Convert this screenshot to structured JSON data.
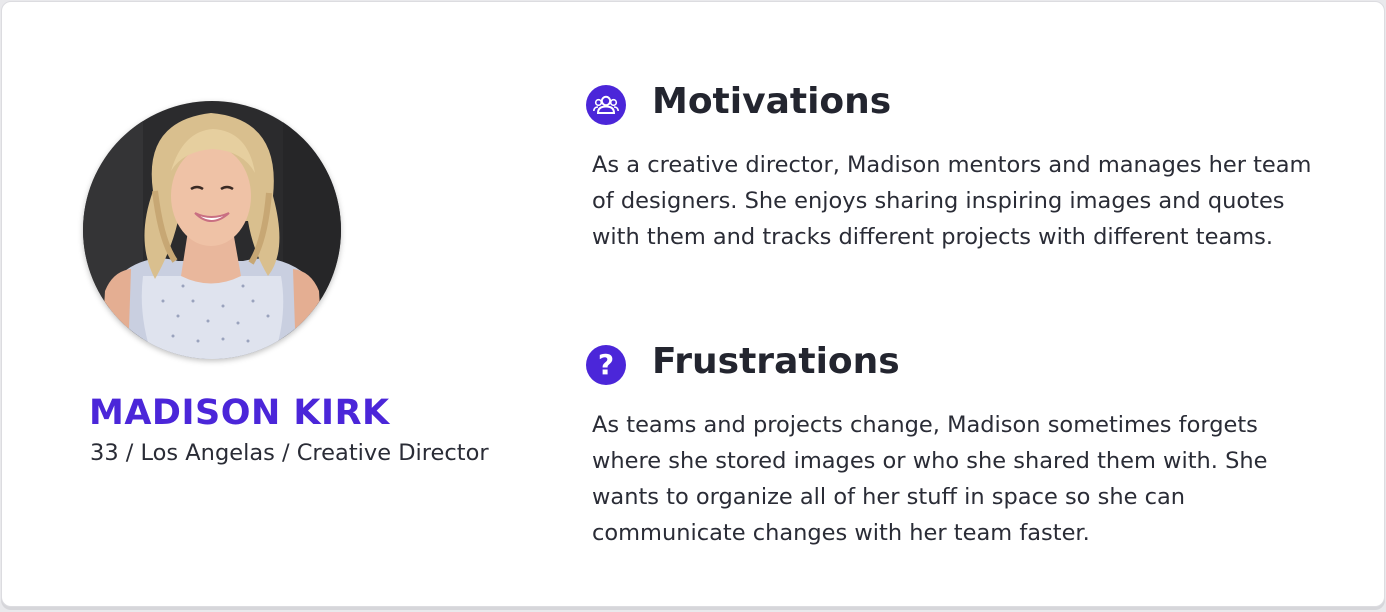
{
  "persona": {
    "name": "MADISON KIRK",
    "meta": "33 / Los Angelas / Creative Director",
    "photo_icon": "person-photo"
  },
  "sections": {
    "motivations": {
      "icon": "users-group-icon",
      "title": "Motivations",
      "body": "As a creative director, Madison mentors and manages her team of designers. She enjoys sharing inspiring images and quotes with them and tracks different projects with different teams."
    },
    "frustrations": {
      "icon": "question-mark-icon",
      "title": "Frustrations",
      "body": "As teams and projects change, Madison sometimes forgets where she stored images or who she shared them with. She wants to organize all of her stuff in space so she can communicate changes with her team faster."
    }
  },
  "colors": {
    "accent": "#4b26d9",
    "text": "#2a2c36",
    "heading": "#23252f"
  }
}
